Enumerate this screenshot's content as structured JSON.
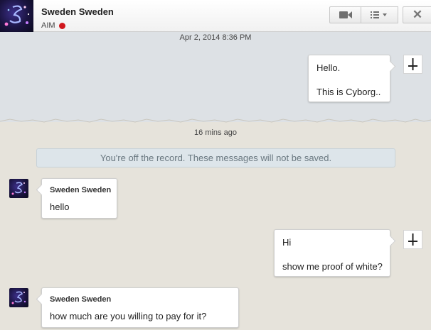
{
  "header": {
    "contact_name": "Sweden Sweden",
    "service": "AIM",
    "status_color": "#d0171d",
    "buttons": {
      "video": "video-camera-icon",
      "menu": "list-menu-icon",
      "close": "✕"
    }
  },
  "history": {
    "timestamp": "Apr 2, 2014 8:36 PM",
    "messages": [
      {
        "from": "self",
        "lines": [
          "Hello.",
          "This is Cyborg.."
        ]
      }
    ]
  },
  "current": {
    "timestamp": "16 mins ago",
    "off_record_notice": "You're off the record. These messages will not be saved.",
    "messages": [
      {
        "from": "contact",
        "sender": "Sweden Sweden",
        "text": "hello"
      },
      {
        "from": "self",
        "lines": [
          "Hi",
          "show me proof of white?"
        ]
      },
      {
        "from": "contact",
        "sender": "Sweden Sweden",
        "text": "how much are you willing to pay for it?"
      }
    ]
  }
}
